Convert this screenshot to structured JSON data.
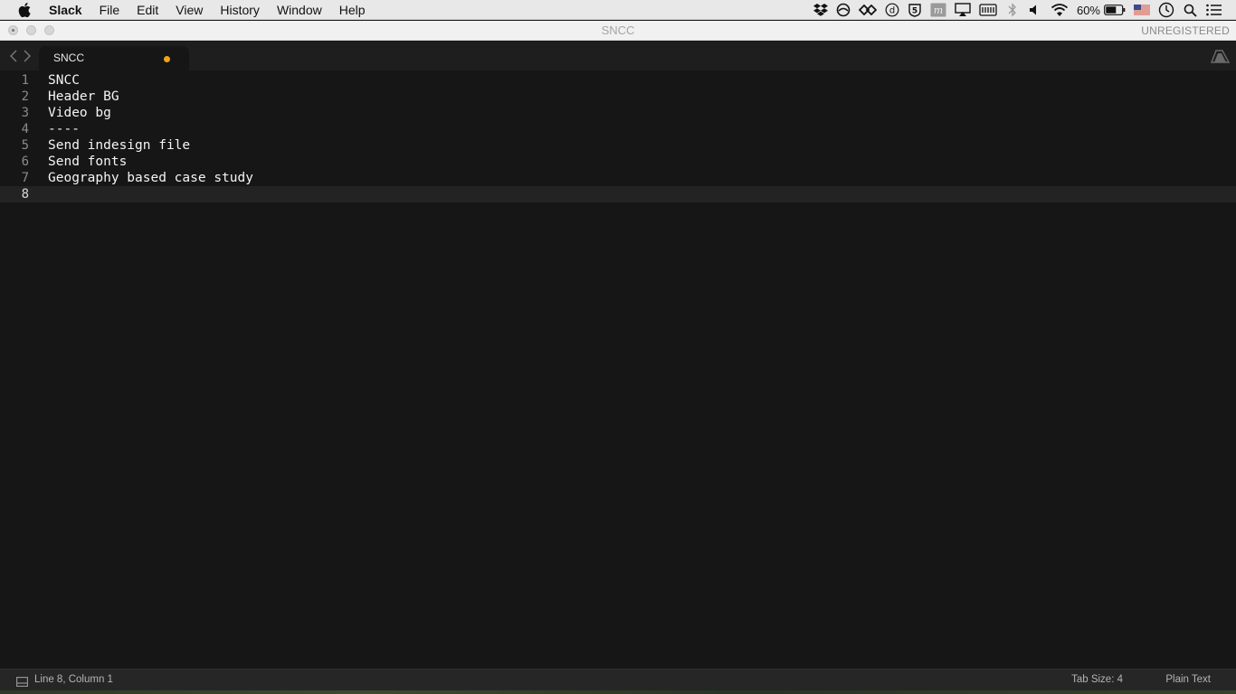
{
  "menubar": {
    "app_name": "Slack",
    "items": [
      "File",
      "Edit",
      "View",
      "History",
      "Window",
      "Help"
    ],
    "battery_percent": "60%",
    "icons": [
      "dropbox-icon",
      "sync-icon",
      "infinity-icon",
      "d-circle-icon",
      "5-shield-icon",
      "m-icon",
      "airplay-icon",
      "keyboard-icon",
      "bluetooth-icon",
      "volume-icon",
      "wifi-icon",
      "battery-icon",
      "us-flag-icon",
      "clock-icon",
      "search-icon",
      "notification-list-icon"
    ]
  },
  "window": {
    "title": "SNCC",
    "registration": "UNREGISTERED"
  },
  "tab": {
    "label": "SNCC",
    "dirty_color": "#f4a21b"
  },
  "editor": {
    "line_numbers": [
      "1",
      "2",
      "3",
      "4",
      "5",
      "6",
      "7",
      "8"
    ],
    "lines": [
      "SNCC",
      "Header BG",
      "Video bg",
      "----",
      "Send indesign file",
      "Send fonts",
      "Geography based case study",
      ""
    ],
    "active_line": 8
  },
  "statusbar": {
    "position": "Line 8, Column 1",
    "tab_size": "Tab Size: 4",
    "syntax": "Plain Text"
  }
}
